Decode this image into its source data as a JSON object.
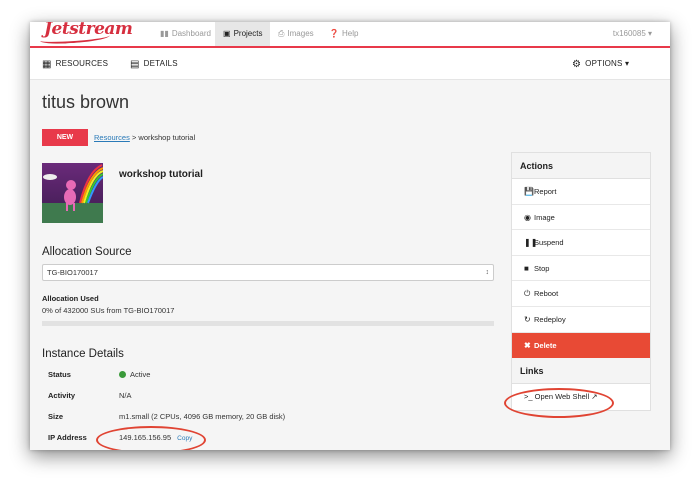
{
  "brand": {
    "logo": "Jetstream",
    "accent": "#e8394a"
  },
  "topnav": {
    "items": [
      {
        "icon": "bar-chart-icon",
        "label": "Dashboard"
      },
      {
        "icon": "folder-open-icon",
        "label": "Projects"
      },
      {
        "icon": "image-icon",
        "label": "Images"
      },
      {
        "icon": "question-icon",
        "label": "Help"
      }
    ],
    "active": "Projects",
    "user": "tx160085 ▾"
  },
  "subnav": {
    "resources": "RESOURCES",
    "details": "DETAILS",
    "options": "OPTIONS ▾"
  },
  "project": {
    "title": "titus brown"
  },
  "breadcrumb": {
    "badge": "NEW",
    "link": "Resources",
    "separator": " > ",
    "current": "workshop tutorial"
  },
  "instance": {
    "name": "workshop tutorial"
  },
  "allocation": {
    "heading": "Allocation Source",
    "selected": "TG-BIO170017",
    "used_label": "Allocation Used",
    "used_text": "0% of 432000 SUs from TG-BIO170017",
    "used_fraction": 0
  },
  "details": {
    "heading": "Instance Details",
    "rows": [
      {
        "key": "Status",
        "value": "Active"
      },
      {
        "key": "Activity",
        "value": "N/A"
      },
      {
        "key": "Size",
        "value": "m1.small (2 CPUs, 4096 GB memory, 20 GB disk)"
      },
      {
        "key": "IP Address",
        "value": "149.165.156.95"
      }
    ],
    "copy": "Copy",
    "status_color": "#3a9a3a"
  },
  "actions": {
    "heading": "Actions",
    "items": [
      {
        "icon": "floppy-icon",
        "label": "Report"
      },
      {
        "icon": "camera-icon",
        "label": "Image"
      },
      {
        "icon": "pause-icon",
        "label": "Suspend"
      },
      {
        "icon": "stop-icon",
        "label": "Stop"
      },
      {
        "icon": "power-icon",
        "label": "Reboot"
      },
      {
        "icon": "redo-icon",
        "label": "Redeploy"
      },
      {
        "icon": "close-icon",
        "label": "Delete"
      }
    ],
    "delete_color": "#e84a35"
  },
  "links": {
    "heading": "Links",
    "web_shell": "Open Web Shell"
  }
}
